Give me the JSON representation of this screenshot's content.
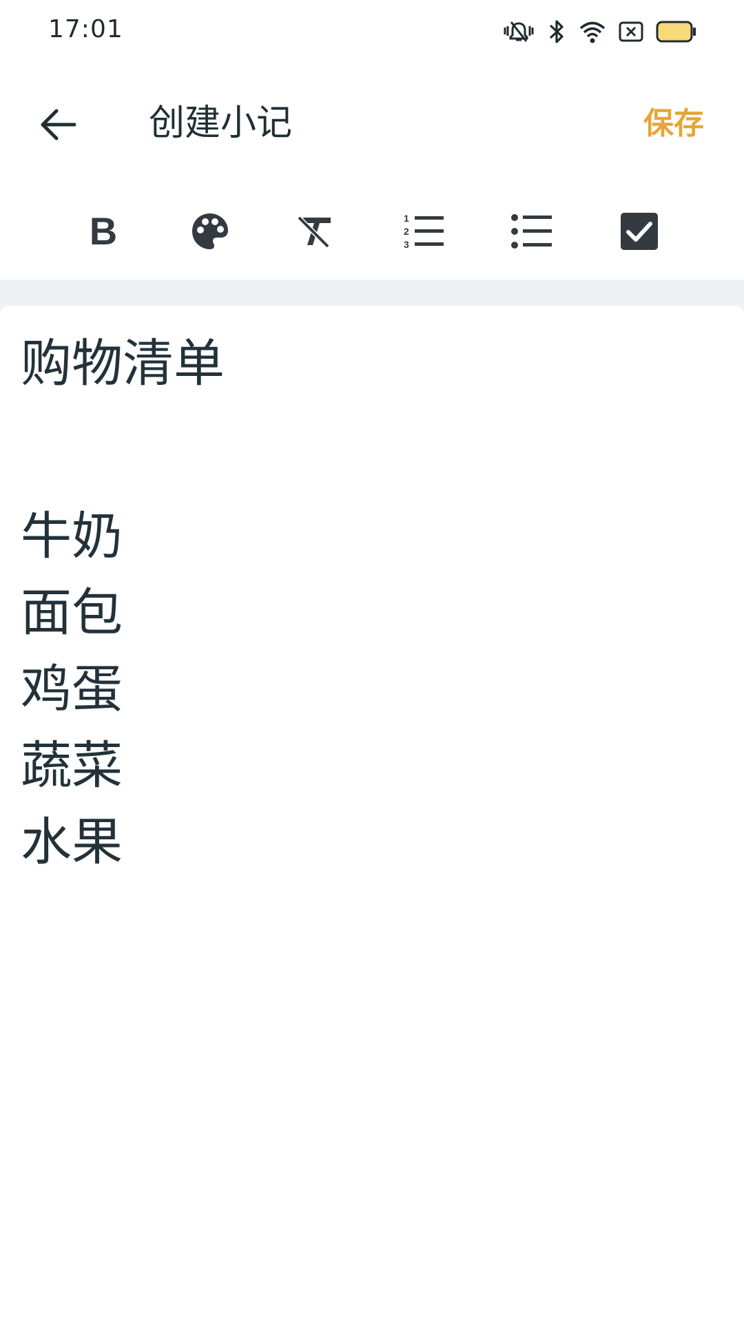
{
  "status_bar": {
    "time": "17:01",
    "icons": [
      "mute-vibrate-icon",
      "bluetooth-icon",
      "wifi-icon",
      "no-sim-icon",
      "battery-icon"
    ]
  },
  "app_bar": {
    "back_icon": "back-arrow-icon",
    "title": "创建小记",
    "save_label": "保存"
  },
  "toolbar": {
    "tools": [
      {
        "name": "bold",
        "icon": "bold-icon",
        "glyph": "B"
      },
      {
        "name": "text-color",
        "icon": "palette-icon"
      },
      {
        "name": "clear-format",
        "icon": "clear-format-icon"
      },
      {
        "name": "ordered-list",
        "icon": "numbered-list-icon"
      },
      {
        "name": "bulleted-list",
        "icon": "bulleted-list-icon"
      },
      {
        "name": "checklist",
        "icon": "checkbox-icon"
      }
    ]
  },
  "note": {
    "title": "购物清单",
    "items": [
      "牛奶",
      "面包",
      "鸡蛋",
      "蔬菜",
      "水果"
    ]
  },
  "colors": {
    "accent": "#e6a537",
    "text": "#23323a",
    "icon": "#333a40",
    "separator": "#eef1f4"
  }
}
